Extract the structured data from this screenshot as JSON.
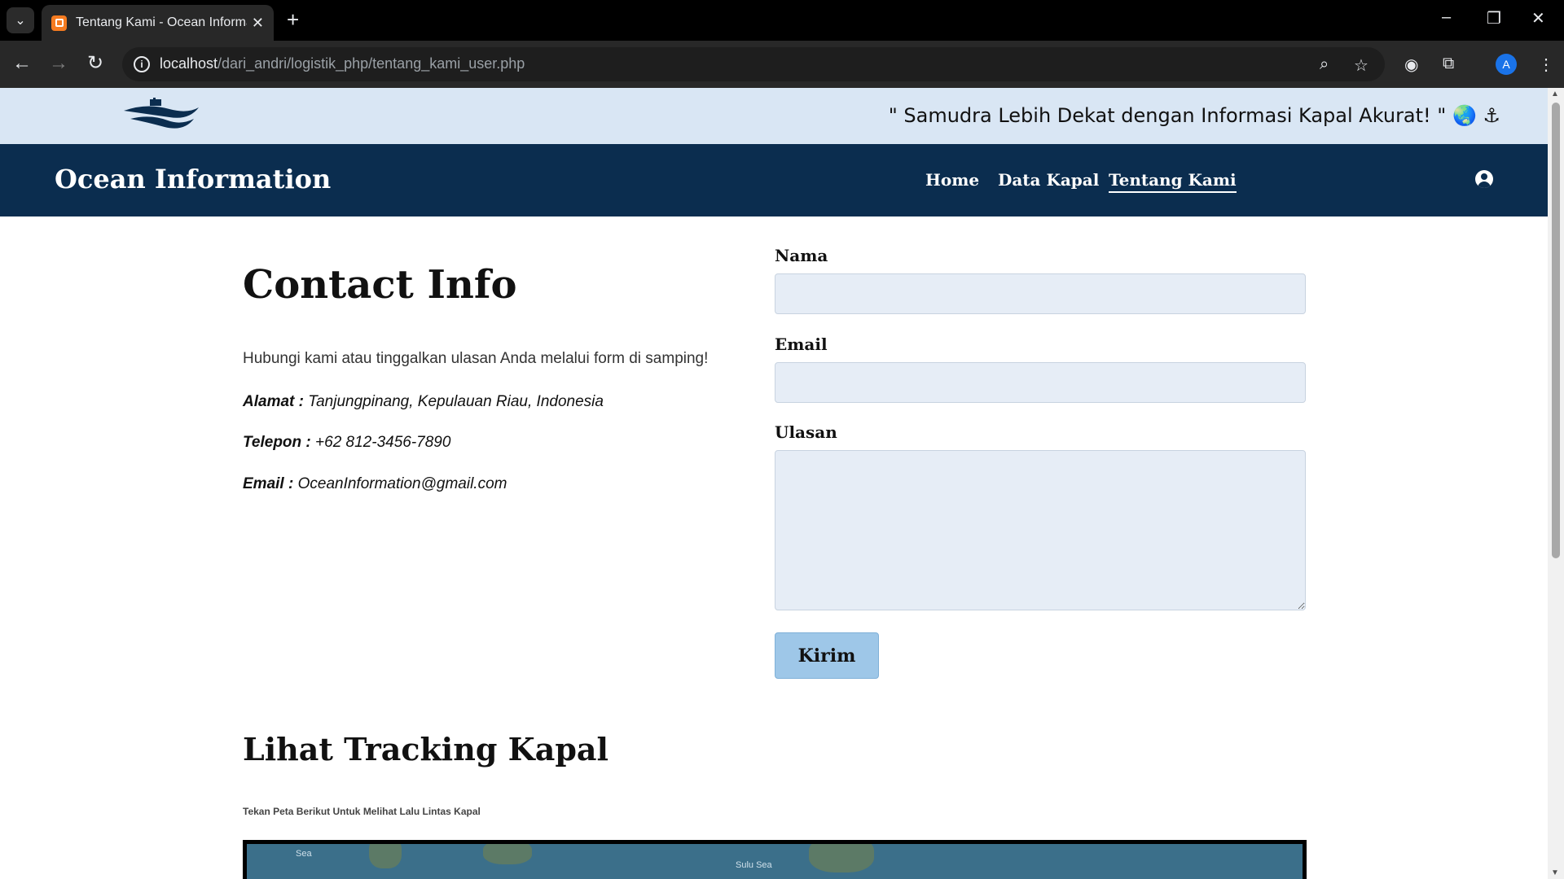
{
  "browser": {
    "tab_title": "Tentang Kami - Ocean Informat",
    "url_host": "localhost",
    "url_path": "/dari_andri/logistik_php/tentang_kami_user.php",
    "avatar_letter": "A"
  },
  "site": {
    "slogan": "\" Samudra Lebih Dekat dengan Informasi Kapal Akurat! \" 🌏 ⚓",
    "brand": "Ocean Information",
    "nav": [
      "Home",
      "Data Kapal",
      "Tentang Kami"
    ],
    "active_nav": "Tentang Kami"
  },
  "contact": {
    "title": "Contact Info",
    "intro": "Hubungi kami atau tinggalkan ulasan Anda melalui form di samping!",
    "address_label": "Alamat :",
    "address_value": "Tanjungpinang, Kepulauan Riau, Indonesia",
    "phone_label": "Telepon :",
    "phone_value": "+62 812-3456-7890",
    "email_label": "Email :",
    "email_value": "OceanInformation@gmail.com"
  },
  "form": {
    "name_label": "Nama",
    "email_label": "Email",
    "review_label": "Ulasan",
    "name_value": "",
    "email_value": "",
    "review_value": "",
    "submit_label": "Kirim"
  },
  "tracking": {
    "title": "Lihat Tracking Kapal",
    "subtitle": "Tekan Peta Berikut Untuk Melihat Lalu Lintas Kapal",
    "map_labels": [
      "Sea",
      "Sulu Sea"
    ]
  },
  "colors": {
    "topbar": "#d9e6f4",
    "navbar": "#0b2d4f",
    "field_bg": "#e6edf6",
    "button": "#9ec7e8"
  }
}
